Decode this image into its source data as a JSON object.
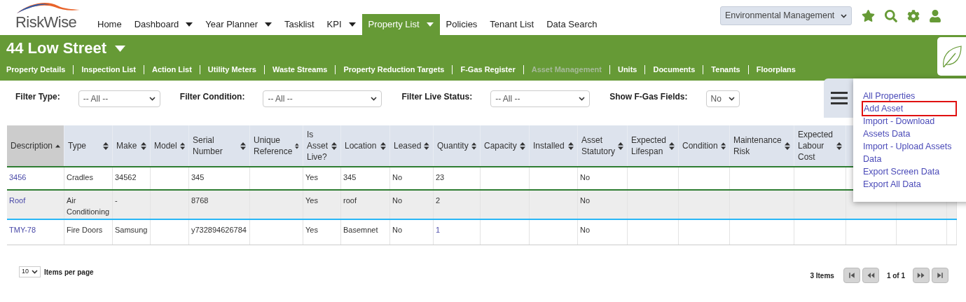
{
  "logo": {
    "text": "RiskWise"
  },
  "nav": [
    {
      "label": "Home",
      "dropdown": false,
      "selected": false
    },
    {
      "label": "Dashboard",
      "dropdown": true,
      "selected": false
    },
    {
      "label": "Year Planner",
      "dropdown": true,
      "selected": false
    },
    {
      "label": "Tasklist",
      "dropdown": false,
      "selected": false
    },
    {
      "label": "KPI",
      "dropdown": true,
      "selected": false
    },
    {
      "label": "Property List",
      "dropdown": true,
      "selected": true
    },
    {
      "label": "Policies",
      "dropdown": false,
      "selected": false
    },
    {
      "label": "Tenant List",
      "dropdown": false,
      "selected": false
    },
    {
      "label": "Data Search",
      "dropdown": false,
      "selected": false
    }
  ],
  "module_select": {
    "value": "Environmental Management"
  },
  "property": {
    "title": "44 Low Street"
  },
  "subnav": [
    {
      "label": "Property Details",
      "disabled": false
    },
    {
      "label": "Inspection List",
      "disabled": false
    },
    {
      "label": "Action List",
      "disabled": false
    },
    {
      "label": "Utility Meters",
      "disabled": false
    },
    {
      "label": "Waste Streams",
      "disabled": false
    },
    {
      "label": "Property Reduction Targets",
      "disabled": false
    },
    {
      "label": "F-Gas Register",
      "disabled": false
    },
    {
      "label": "Asset Management",
      "disabled": true
    },
    {
      "label": "Units",
      "disabled": false
    },
    {
      "label": "Documents",
      "disabled": false
    },
    {
      "label": "Tenants",
      "disabled": false
    },
    {
      "label": "Floorplans",
      "disabled": false
    }
  ],
  "filters": [
    {
      "label": "Filter Type:",
      "value": "-- All --"
    },
    {
      "label": "Filter Condition:",
      "value": "-- All --"
    },
    {
      "label": "Filter Live Status:",
      "value": "-- All --"
    },
    {
      "label": "Show F-Gas Fields:",
      "value": "No"
    }
  ],
  "menu": [
    {
      "label": "All Properties",
      "selected": false
    },
    {
      "label": "Add Asset",
      "selected": true
    },
    {
      "label": "Import - Download Assets Data",
      "selected": false
    },
    {
      "label": "Import - Upload Assets Data",
      "selected": false
    },
    {
      "label": "Export Screen Data",
      "selected": false
    },
    {
      "label": "Export All Data",
      "selected": false
    }
  ],
  "table": {
    "columns": [
      {
        "label": "Description",
        "sorted": true
      },
      {
        "label": "Type",
        "sorted": false
      },
      {
        "label": "Make",
        "sorted": false
      },
      {
        "label": "Model",
        "sorted": false
      },
      {
        "label": "Serial Number",
        "sorted": false
      },
      {
        "label": "Unique Reference",
        "sorted": false
      },
      {
        "label": "Is Asset Live?",
        "sorted": false
      },
      {
        "label": "Location",
        "sorted": false
      },
      {
        "label": "Leased",
        "sorted": false
      },
      {
        "label": "Quantity",
        "sorted": false
      },
      {
        "label": "Capacity",
        "sorted": false
      },
      {
        "label": "Installed",
        "sorted": false
      },
      {
        "label": "Asset Statutory",
        "sorted": false
      },
      {
        "label": "Expected Lifespan",
        "sorted": false
      },
      {
        "label": "Condition",
        "sorted": false
      },
      {
        "label": "Maintenance Risk",
        "sorted": false
      },
      {
        "label": "Expected Labour Cost",
        "sorted": false
      }
    ],
    "rows": [
      {
        "selected": false,
        "cells": [
          "3456",
          "Cradles",
          "34562",
          "",
          "345",
          "",
          "Yes",
          "345",
          "No",
          "23",
          "",
          "",
          "No",
          "",
          "",
          "",
          ""
        ]
      },
      {
        "selected": true,
        "cells": [
          "Roof",
          "Air Conditioning",
          "-",
          "",
          "8768",
          "",
          "Yes",
          "roof",
          "No",
          "2",
          "",
          "",
          "No",
          "",
          "",
          "",
          ""
        ]
      },
      {
        "selected": false,
        "cells": [
          "TMY-78",
          "Fire Doors",
          "Samsung",
          "",
          "y732894626784",
          "",
          "Yes",
          "Basemnet",
          "No",
          "1",
          "",
          "",
          "No",
          "",
          "",
          "",
          ""
        ]
      }
    ]
  },
  "pager": {
    "page_size": "10",
    "page_size_label": "Items per page",
    "count": "3 Items",
    "page": "1 of 1"
  }
}
